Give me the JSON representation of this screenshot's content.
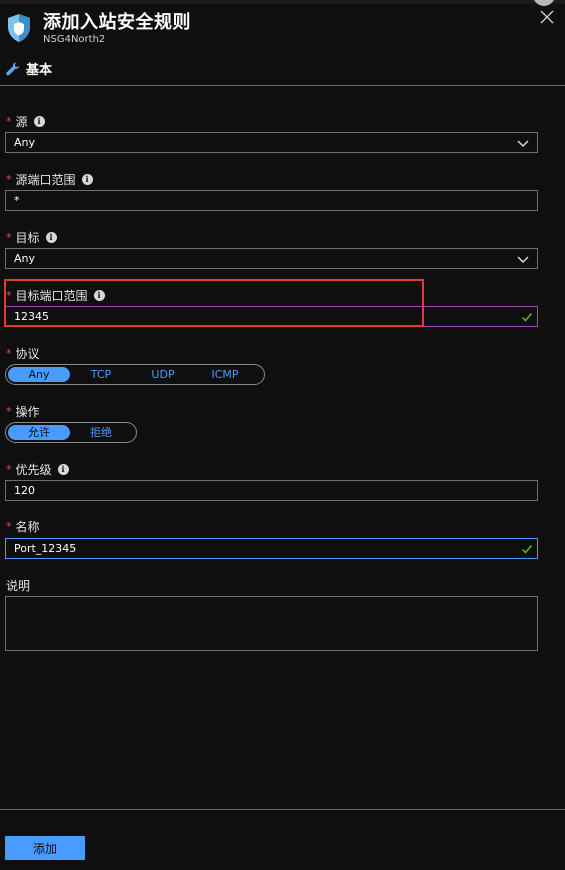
{
  "header": {
    "title": "添加入站安全规则",
    "subtitle": "NSG4North2"
  },
  "tab": {
    "label": "基本"
  },
  "fields": {
    "source": {
      "label": "源",
      "value": "Any"
    },
    "source_port": {
      "label": "源端口范围",
      "value": "*"
    },
    "destination": {
      "label": "目标",
      "value": "Any"
    },
    "dest_port": {
      "label": "目标端口范围",
      "value": "12345"
    },
    "protocol": {
      "label": "协议",
      "options": [
        "Any",
        "TCP",
        "UDP",
        "ICMP"
      ],
      "selected": "Any"
    },
    "action": {
      "label": "操作",
      "options": [
        "允许",
        "拒绝"
      ],
      "selected": "允许"
    },
    "priority": {
      "label": "优先级",
      "value": "120"
    },
    "name": {
      "label": "名称",
      "value": "Port_12345"
    },
    "description": {
      "label": "说明",
      "value": ""
    }
  },
  "footer": {
    "add_label": "添加"
  },
  "colors": {
    "accent": "#4a9bff",
    "required": "#e84a4a",
    "valid_check": "#5fb832",
    "highlight": "#e53935",
    "background": "#0f0f0f"
  }
}
